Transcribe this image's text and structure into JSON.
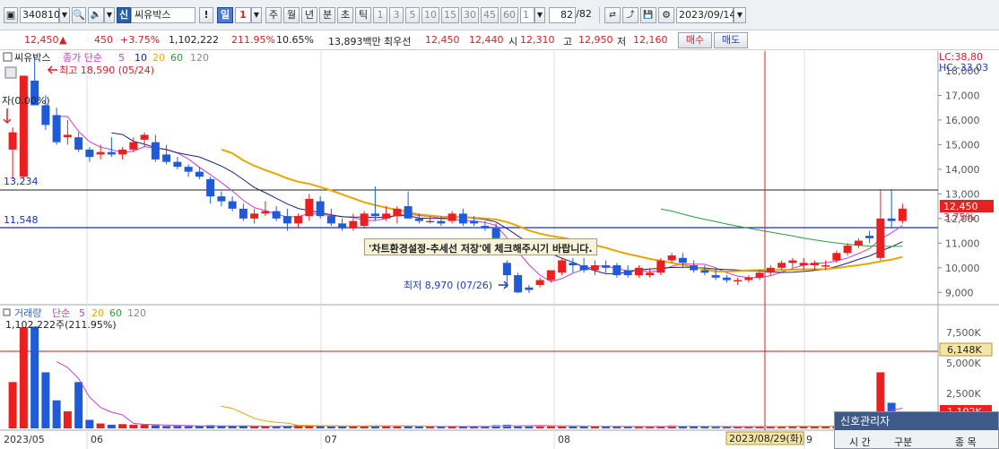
{
  "toolbar": {
    "stock_code": "340810",
    "market_badge": "신",
    "stock_name": "씨유박스",
    "info_label": "!",
    "period_day": "일",
    "period_value": "1",
    "period_week": "주",
    "period_month": "월",
    "period_year": "년",
    "period_minute": "분",
    "period_second": "초",
    "period_tick": "틱",
    "intervals": [
      "1",
      "3",
      "5",
      "10",
      "15",
      "30",
      "45",
      "60"
    ],
    "interval_input": "1",
    "count": "82",
    "count_total": "/82",
    "date": "2023/09/14"
  },
  "quote": {
    "price": "12,450",
    "arrow": "▲",
    "change": "450",
    "change_pct": "+3.75%",
    "volume": "1,102,222",
    "volume_ratio": "211.95%",
    "turnover": "10.65%",
    "amount": "13,893백만",
    "best_label": "최우선",
    "best_ask": "12,450",
    "best_bid": "12,440",
    "open_label": "시",
    "open": "12,310",
    "high_label": "고",
    "high": "12,950",
    "low_label": "저",
    "low": "12,160",
    "buy_button": "매수",
    "sell_button": "매도"
  },
  "price_panel": {
    "stock_label": "씨유박스",
    "ma_label": "종가 단순",
    "ma_periods": [
      "5",
      "10",
      "20",
      "60",
      "120"
    ],
    "high_annotation": "최고 18,590 (05/24)",
    "low_annotation": "최저 8,970 (07/26)",
    "left_marker": "자(0.00%)",
    "level_upper": "13,234",
    "level_lower": "11,548",
    "lc_label": "LC:38,80",
    "hc_label": "HC:-33,03",
    "y_ticks": [
      "18,000",
      "17,000",
      "16,000",
      "15,000",
      "14,000",
      "13,000",
      "12,000",
      "11,000",
      "10,000",
      "9,000"
    ],
    "current_price_tag": "12,450",
    "current_pct_tag": "3.75%",
    "notice": "'차트환경설정-추세선 저장'에 체크해주시기 바랍니다."
  },
  "volume_panel": {
    "title": "거래량",
    "ma_label": "단순",
    "ma_periods": [
      "5",
      "20",
      "60",
      "120"
    ],
    "current_label": "1,102,222주(211.95%)",
    "y_ticks": [
      "7,500K",
      "5,000K",
      "2,500K"
    ],
    "level_tag": "6,148K",
    "bottom_tag": "1,102K"
  },
  "x_axis": {
    "labels": [
      "2023/05",
      "06",
      "07",
      "08",
      "9"
    ],
    "crosshair_date": "2023/08/29(화)"
  },
  "signal_panel": {
    "title": "신호관리자",
    "col_time": "시 간",
    "col_type": "구분",
    "col_item": "종 목"
  },
  "colors": {
    "up": "#e8201f",
    "down": "#1f5bd8",
    "ma5": "#c83ccd",
    "ma10": "#1a237e",
    "ma20": "#e8a700",
    "ma60": "#2e9d3a",
    "crosshair": "#d6202a"
  },
  "chart_data": {
    "type": "candlestick",
    "x_start": "2023/05/22",
    "x_end": "2023/09/14",
    "ylim": [
      8500,
      18800
    ],
    "candles": [
      [
        14800,
        15700,
        13600,
        15500
      ],
      [
        13700,
        17800,
        13600,
        17800
      ],
      [
        17600,
        18590,
        16600,
        16600
      ],
      [
        16600,
        17000,
        15600,
        15800
      ],
      [
        16200,
        16500,
        15000,
        15100
      ],
      [
        15300,
        16000,
        15000,
        15400
      ],
      [
        15300,
        15500,
        14700,
        14800
      ],
      [
        14800,
        14900,
        14300,
        14500
      ],
      [
        14600,
        15000,
        14400,
        14700
      ],
      [
        14700,
        15300,
        14500,
        14600
      ],
      [
        14600,
        14900,
        14400,
        14800
      ],
      [
        14800,
        15300,
        14700,
        15100
      ],
      [
        15200,
        15500,
        14900,
        15400
      ],
      [
        15100,
        15400,
        14300,
        14400
      ],
      [
        14600,
        15000,
        14200,
        14300
      ],
      [
        14300,
        14500,
        14000,
        14100
      ],
      [
        14100,
        14200,
        13700,
        13900
      ],
      [
        13900,
        14100,
        13600,
        13700
      ],
      [
        13600,
        13700,
        12600,
        12900
      ],
      [
        12900,
        13100,
        12500,
        12700
      ],
      [
        12700,
        12900,
        12300,
        12400
      ],
      [
        12400,
        12600,
        11900,
        12000
      ],
      [
        12000,
        12400,
        11800,
        12200
      ],
      [
        12200,
        12700,
        12100,
        12300
      ],
      [
        12300,
        12500,
        11900,
        12000
      ],
      [
        12100,
        12400,
        11500,
        11800
      ],
      [
        11800,
        12200,
        11600,
        12100
      ],
      [
        12100,
        13000,
        11900,
        12800
      ],
      [
        12700,
        12900,
        12000,
        12100
      ],
      [
        12100,
        12400,
        11700,
        11800
      ],
      [
        11800,
        12000,
        11500,
        11600
      ],
      [
        11600,
        12200,
        11500,
        11900
      ],
      [
        11700,
        12300,
        11600,
        12200
      ],
      [
        12200,
        13300,
        11900,
        12100
      ],
      [
        12000,
        12500,
        11900,
        12200
      ],
      [
        12100,
        12500,
        11800,
        12400
      ],
      [
        12500,
        13100,
        12300,
        12000
      ],
      [
        12000,
        12200,
        11800,
        11900
      ],
      [
        11900,
        12100,
        11800,
        11900
      ],
      [
        11900,
        12100,
        11700,
        11800
      ],
      [
        11900,
        12300,
        11800,
        12200
      ],
      [
        12200,
        12400,
        11700,
        11800
      ],
      [
        11900,
        12100,
        11700,
        11800
      ],
      [
        11700,
        11900,
        11500,
        11600
      ],
      [
        11600,
        11800,
        11200,
        11200
      ],
      [
        10200,
        10300,
        9200,
        9700
      ],
      [
        9700,
        9800,
        8970,
        9000
      ],
      [
        9200,
        9300,
        8970,
        9100
      ],
      [
        9300,
        9600,
        9200,
        9500
      ],
      [
        9500,
        9900,
        9400,
        9900
      ],
      [
        9800,
        10400,
        9700,
        10300
      ],
      [
        10200,
        10400,
        9800,
        10100
      ],
      [
        10100,
        10400,
        9800,
        9900
      ],
      [
        9900,
        10300,
        9700,
        10100
      ],
      [
        10100,
        10300,
        9800,
        10000
      ],
      [
        10100,
        10200,
        9600,
        9700
      ],
      [
        9900,
        10100,
        9600,
        9700
      ],
      [
        9700,
        10100,
        9600,
        10000
      ],
      [
        9700,
        10000,
        9600,
        9800
      ],
      [
        9800,
        10400,
        9700,
        10300
      ],
      [
        10300,
        10600,
        10200,
        10500
      ],
      [
        10400,
        10600,
        10000,
        10200
      ],
      [
        10100,
        10300,
        9800,
        9900
      ],
      [
        9900,
        10100,
        9700,
        9800
      ],
      [
        9700,
        10000,
        9500,
        9600
      ],
      [
        9600,
        9700,
        9400,
        9500
      ],
      [
        9500,
        9600,
        9300,
        9500
      ],
      [
        9500,
        9700,
        9400,
        9600
      ],
      [
        9600,
        9900,
        9500,
        9800
      ],
      [
        9800,
        10100,
        9700,
        10000
      ],
      [
        10000,
        10300,
        9900,
        10200
      ],
      [
        10200,
        10400,
        10000,
        10300
      ],
      [
        10100,
        10400,
        9900,
        10200
      ],
      [
        10100,
        10300,
        9900,
        10200
      ],
      [
        10100,
        10300,
        9900,
        10100
      ],
      [
        10300,
        10700,
        10200,
        10600
      ],
      [
        10600,
        11000,
        10500,
        10900
      ],
      [
        10900,
        11200,
        10800,
        11100
      ],
      [
        11300,
        11500,
        11000,
        11200
      ],
      [
        10400,
        13200,
        10300,
        12000
      ],
      [
        12000,
        13200,
        11600,
        11900
      ],
      [
        11900,
        12600,
        11800,
        12400
      ]
    ],
    "volume_k": [
      3800,
      8300,
      8350,
      4600,
      2300,
      1400,
      3800,
      700,
      400,
      300,
      350,
      300,
      300,
      250,
      200,
      200,
      180,
      180,
      260,
      200,
      180,
      200,
      160,
      160,
      160,
      200,
      250,
      220,
      180,
      160,
      160,
      200,
      220,
      230,
      200,
      180,
      200,
      150,
      140,
      140,
      160,
      170,
      160,
      140,
      260,
      300,
      220,
      200,
      180,
      200,
      220,
      180,
      160,
      170,
      150,
      160,
      140,
      130,
      120,
      180,
      240,
      200,
      160,
      140,
      130,
      120,
      120,
      150,
      170,
      160,
      180,
      200,
      180,
      160,
      150,
      180,
      230,
      240,
      260,
      4600,
      2100,
      1102
    ]
  }
}
